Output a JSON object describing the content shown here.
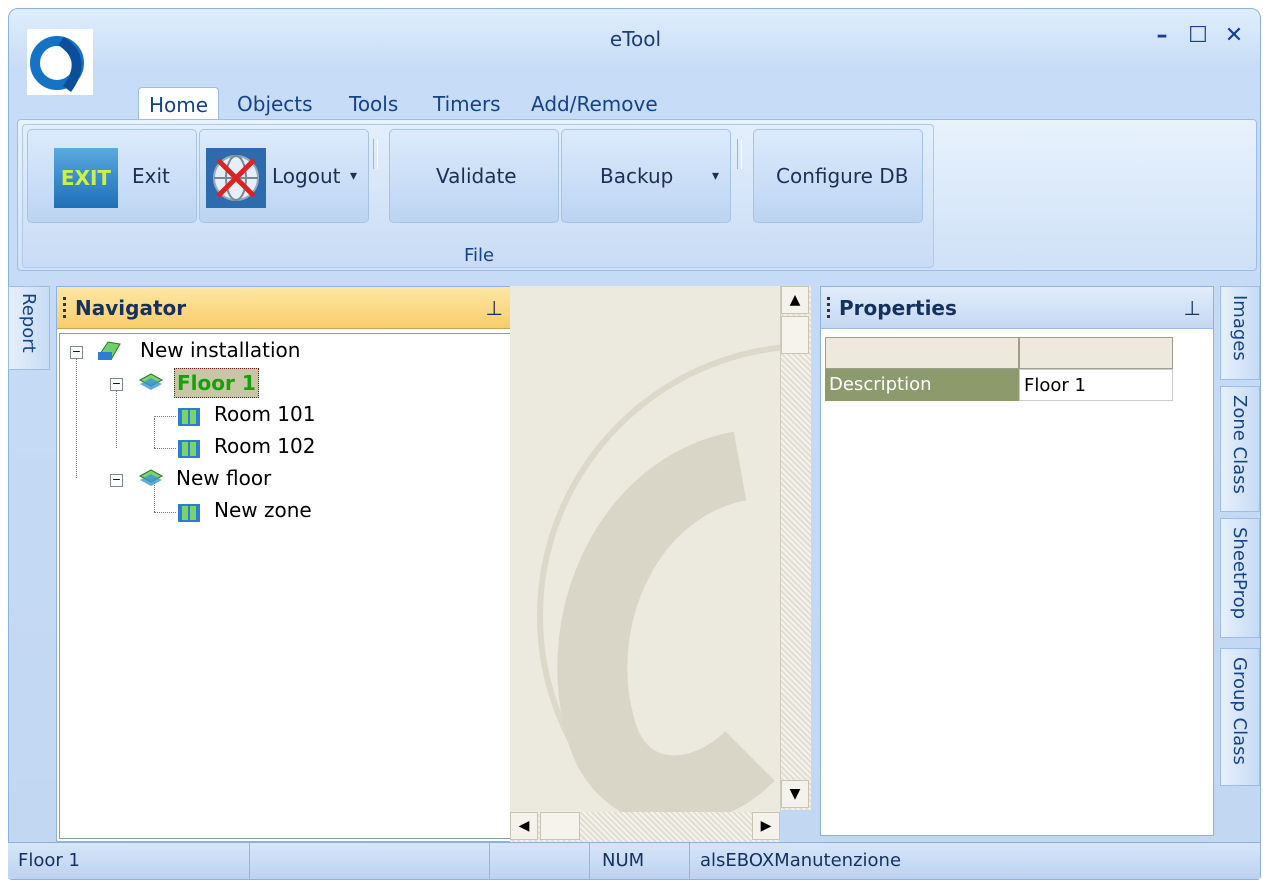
{
  "window": {
    "title": "eTool",
    "minimize": "–",
    "maximize": "☐",
    "close": "✕"
  },
  "tabs": [
    "Home",
    "Objects",
    "Tools",
    "Timers",
    "Add/Remove"
  ],
  "ribbon": {
    "group_label": "File",
    "exit_icon_text": "EXIT",
    "exit_label": "Exit",
    "logout_label": "Logout",
    "logout_arrow": "▾",
    "validate_label": "Validate",
    "backup_label": "Backup",
    "backup_arrow": "▾",
    "configure_label": "Configure DB"
  },
  "left_tabs": [
    "Report"
  ],
  "right_tabs": [
    "Images",
    "Zone Class",
    "SheetProp",
    "Group Class"
  ],
  "navigator": {
    "title": "Navigator",
    "pin": "⊥",
    "tree": {
      "root": "New installation",
      "floor1": "Floor 1",
      "room101": "Room 101",
      "room102": "Room 102",
      "floor2": "New floor",
      "zone": "New zone",
      "expand_glyph": "−"
    }
  },
  "properties": {
    "title": "Properties",
    "pin": "⊥",
    "rows": [
      {
        "key": "Description",
        "value": "Floor 1"
      }
    ]
  },
  "scroll": {
    "up": "▲",
    "down": "▼",
    "left": "◀",
    "right": "▶"
  },
  "status": {
    "item": "Floor 1",
    "num": "NUM",
    "user": "alsEBOXManutenzione"
  },
  "colors": {
    "accent": "#15428b",
    "nav_header": "#fbd77a",
    "prop_header": "#cfe0f7",
    "selected_node": "#16a00a",
    "prop_key_bg": "#8c9a6c"
  }
}
